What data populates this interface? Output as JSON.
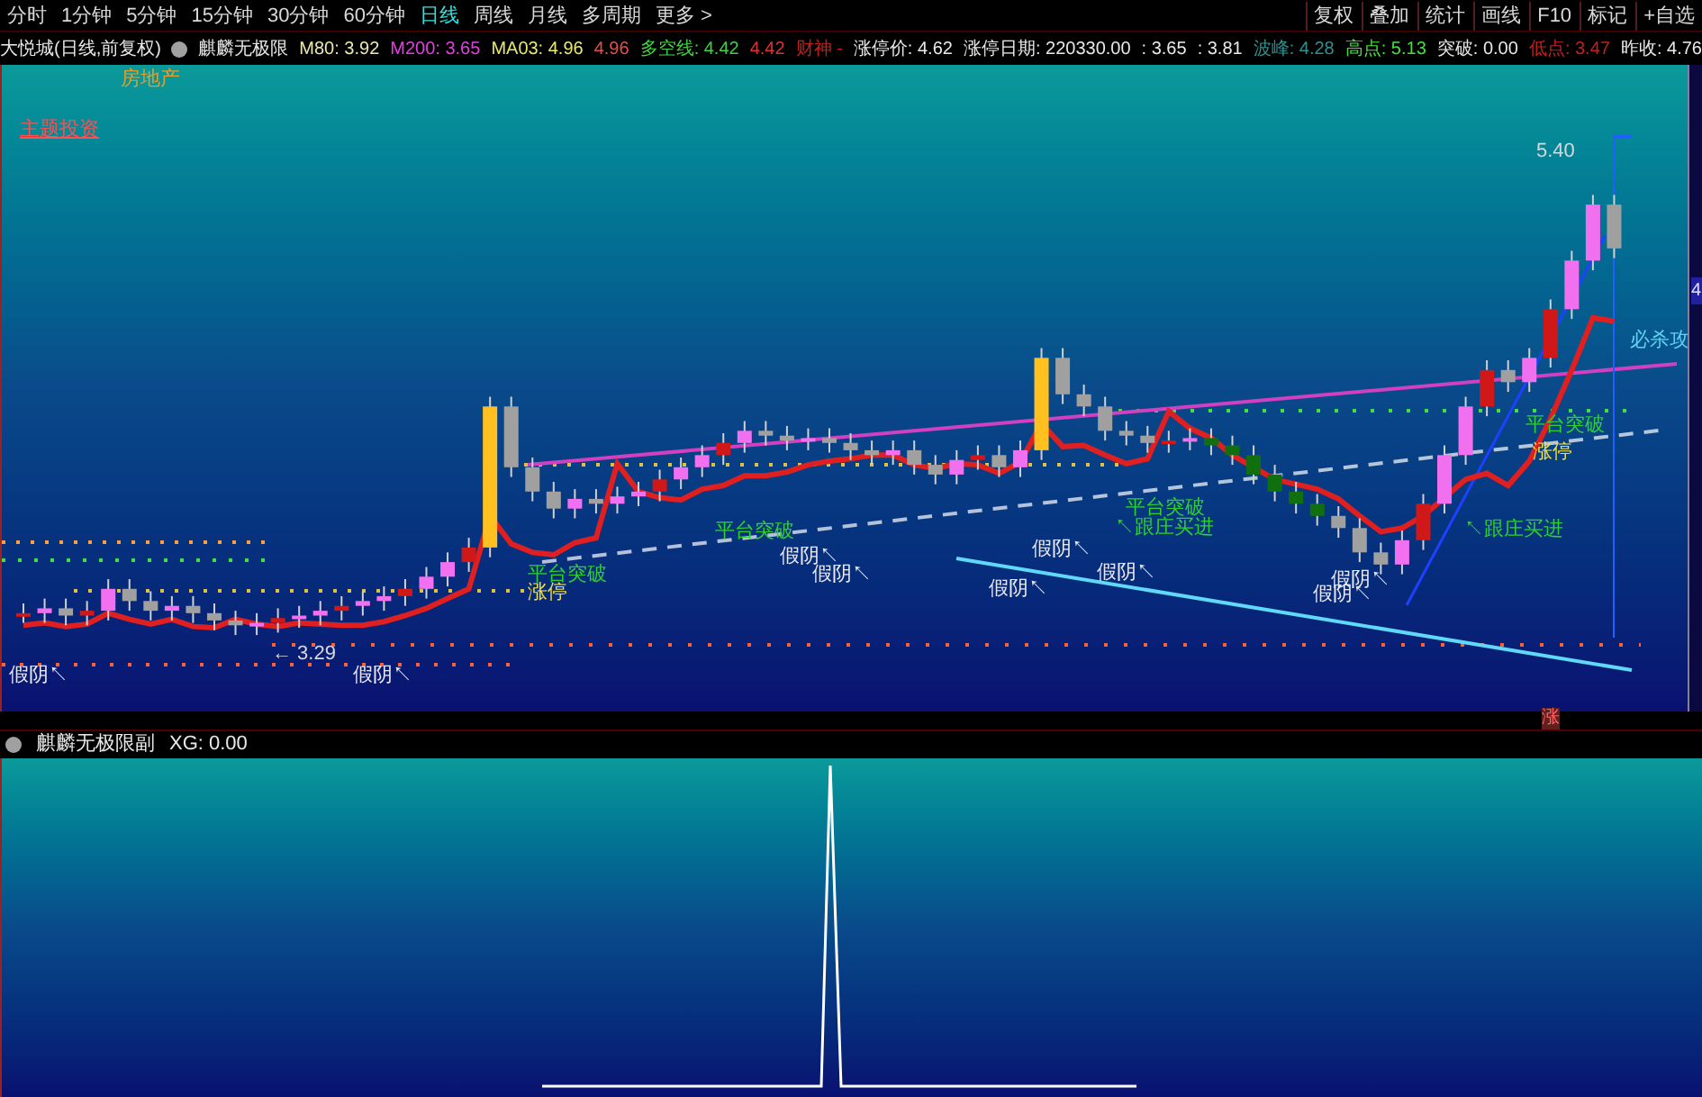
{
  "toolbar": {
    "periods": [
      {
        "label": "分时",
        "selected": false
      },
      {
        "label": "1分钟",
        "selected": false
      },
      {
        "label": "5分钟",
        "selected": false
      },
      {
        "label": "15分钟",
        "selected": false
      },
      {
        "label": "30分钟",
        "selected": false
      },
      {
        "label": "60分钟",
        "selected": false
      },
      {
        "label": "日线",
        "selected": true
      },
      {
        "label": "周线",
        "selected": false
      },
      {
        "label": "月线",
        "selected": false
      },
      {
        "label": "多周期",
        "selected": false
      },
      {
        "label": "更多 >",
        "selected": false
      }
    ],
    "buttons": [
      "复权",
      "叠加",
      "统计",
      "画线",
      "F10",
      "标记",
      "+自选"
    ]
  },
  "info_bar": {
    "stock": "大悦城(日线,前复权)",
    "indicator": "麒麟无极限",
    "values": [
      {
        "text": "M80: 3.92",
        "color": "#e8e8b0"
      },
      {
        "text": "M200: 3.65",
        "color": "#e040e0"
      },
      {
        "text": "MA03: 4.96",
        "color": "#e8e870"
      },
      {
        "text": "4.96",
        "color": "#e05050"
      },
      {
        "text": "多空线: 4.42",
        "color": "#40d040"
      },
      {
        "text": "4.42",
        "color": "#e03030"
      },
      {
        "text": "财神 -",
        "color": "#c02020"
      },
      {
        "text": "涨停价: 4.62",
        "color": "#e8e8e8"
      },
      {
        "text": "涨停日期: 220330.00",
        "color": "#e8e8e8"
      },
      {
        "text": ": 3.65",
        "color": "#e8e8e8"
      },
      {
        "text": ": 3.81",
        "color": "#e8e8e8"
      },
      {
        "text": "波峰: 4.28",
        "color": "#309090"
      },
      {
        "text": "高点: 5.13",
        "color": "#40e040"
      },
      {
        "text": "突破: 0.00",
        "color": "#e8e8e8"
      },
      {
        "text": "低点: 3.47",
        "color": "#c02020"
      },
      {
        "text": "昨收: 4.76",
        "color": "#e8e8e8"
      }
    ]
  },
  "chart": {
    "sector_tag": "房地产",
    "theme_tag": "主题投资",
    "axis_label": "4",
    "marker": "涨",
    "annotations": [
      {
        "text": "5.40",
        "kind": "price"
      },
      {
        "text": "← 3.29",
        "kind": "price"
      },
      {
        "text": "假阴↖",
        "kind": "signal"
      },
      {
        "text": "假阴↖",
        "kind": "signal"
      },
      {
        "text": "假阴↖",
        "kind": "signal"
      },
      {
        "text": "假阴↖",
        "kind": "signal"
      },
      {
        "text": "假阴↖",
        "kind": "signal"
      },
      {
        "text": "假阴↖",
        "kind": "signal"
      },
      {
        "text": "假阴↖",
        "kind": "signal"
      },
      {
        "text": "假阴↖",
        "kind": "signal"
      },
      {
        "text": "假阴↖",
        "kind": "signal"
      },
      {
        "text": "平台突破",
        "kind": "buy"
      },
      {
        "text": "涨停",
        "kind": "limit"
      },
      {
        "text": "平台突破",
        "kind": "buy"
      },
      {
        "text": "平台突破",
        "kind": "buy"
      },
      {
        "text": "↖跟庄买进",
        "kind": "buy"
      },
      {
        "text": "↖跟庄买进",
        "kind": "buy"
      },
      {
        "text": "平台突破",
        "kind": "buy"
      },
      {
        "text": "涨停",
        "kind": "limit"
      },
      {
        "text": "必杀攻",
        "kind": "attack"
      }
    ]
  },
  "sub_panel": {
    "title": "麒麟无极限副",
    "value": "XG: 0.00"
  }
}
